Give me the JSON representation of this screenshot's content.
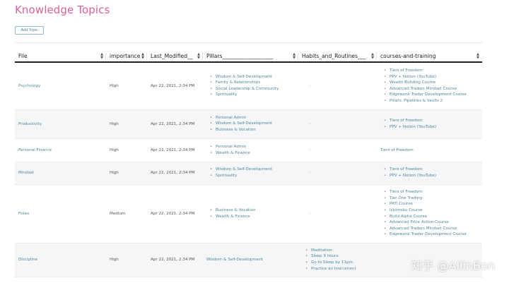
{
  "page": {
    "title": "Knowledge Topics",
    "add_button_label": "Add Topic"
  },
  "table": {
    "columns": [
      "File",
      "importance",
      "Last_Modified__",
      "Pillars___________________",
      "Habits_and_Routines___",
      "courses-and-training"
    ],
    "rows": [
      {
        "file": "Psychology",
        "importance": "High",
        "modified": "Apr 22, 2021, 2:34 PM",
        "pillars": [
          "Wisdom & Self-Development",
          "Family & Relationships",
          "Social Leadership & Community",
          "Spirituality"
        ],
        "habits": [],
        "courses": [
          "Tiers of Freedom",
          "PPV + Notion (YouTube)",
          "Wealth Building Course",
          "Advanced Traders Mindset Course",
          "Edgewonk Trader Development Course",
          "Pillars, Pipelines & Vaults 2"
        ]
      },
      {
        "file": "Productivity",
        "importance": "High",
        "modified": "Apr 22, 2021, 2:34 PM",
        "pillars": [
          "Personal Admin",
          "Wisdom & Self-Development",
          "Business & Vocation"
        ],
        "habits": [],
        "courses": [
          "Tiers of Freedom",
          "PPV + Notion (YouTube)"
        ]
      },
      {
        "file": "Personal Finance",
        "importance": "High",
        "modified": "Apr 22, 2021, 2:34 PM",
        "pillars": [
          "Personal Admin",
          "Wealth & Finance"
        ],
        "habits": [],
        "courses_plain": "Tiers of Freedom"
      },
      {
        "file": "Mindset",
        "importance": "High",
        "modified": "Apr 22, 2021, 2:34 PM",
        "pillars": [
          "Wisdom & Self-Development",
          "Spirituality"
        ],
        "habits": [],
        "courses": [
          "Tiers of Freedom",
          "PPV + Notion (YouTube)"
        ]
      },
      {
        "file": "Forex",
        "importance": "Medium",
        "modified": "Apr 22, 2021, 2:34 PM",
        "pillars": [
          "Business & Vocation",
          "Wealth & Finance"
        ],
        "habits": [],
        "courses": [
          "Tiers of Freedom",
          "Tier One Trading",
          "PATI Course",
          "Ichimoku Course",
          "Build Alpha Course",
          "Advanced Price Action Course",
          "Advanced Traders Mindset Course",
          "Edgewonk Trader Development Course"
        ]
      },
      {
        "file": "Discipline",
        "importance": "High",
        "modified": "Apr 22, 2021, 2:34 PM",
        "pillars_plain": "Wisdom & Self-Development",
        "habits": [
          "Meditation",
          "Sleep 9 hours",
          "Go to Sleep by 11pm",
          "Practice an Instrument"
        ],
        "courses": []
      }
    ],
    "empty_marker": "-"
  },
  "watermark": "知乎 @AllinBon"
}
